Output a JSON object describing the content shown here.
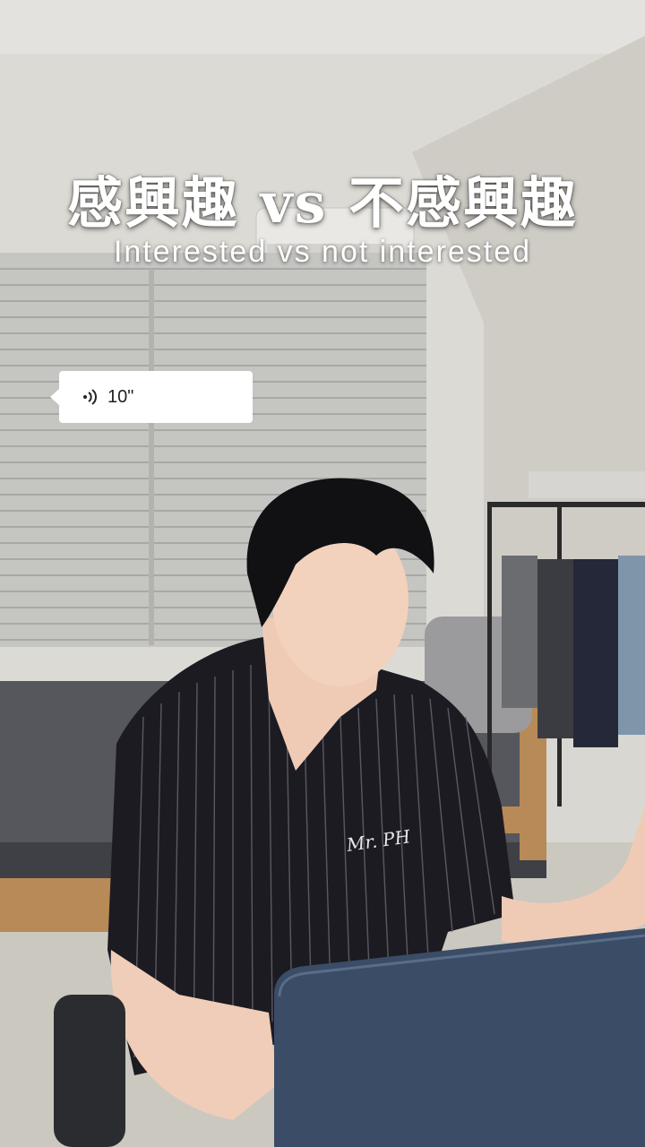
{
  "overlay": {
    "title": "感興趣 vs 不感興趣",
    "subtitle": "Interested vs not interested"
  },
  "voice_message": {
    "icon": "voice-wave-icon",
    "duration": "10\""
  },
  "shirt_logo": "Mr. PH"
}
